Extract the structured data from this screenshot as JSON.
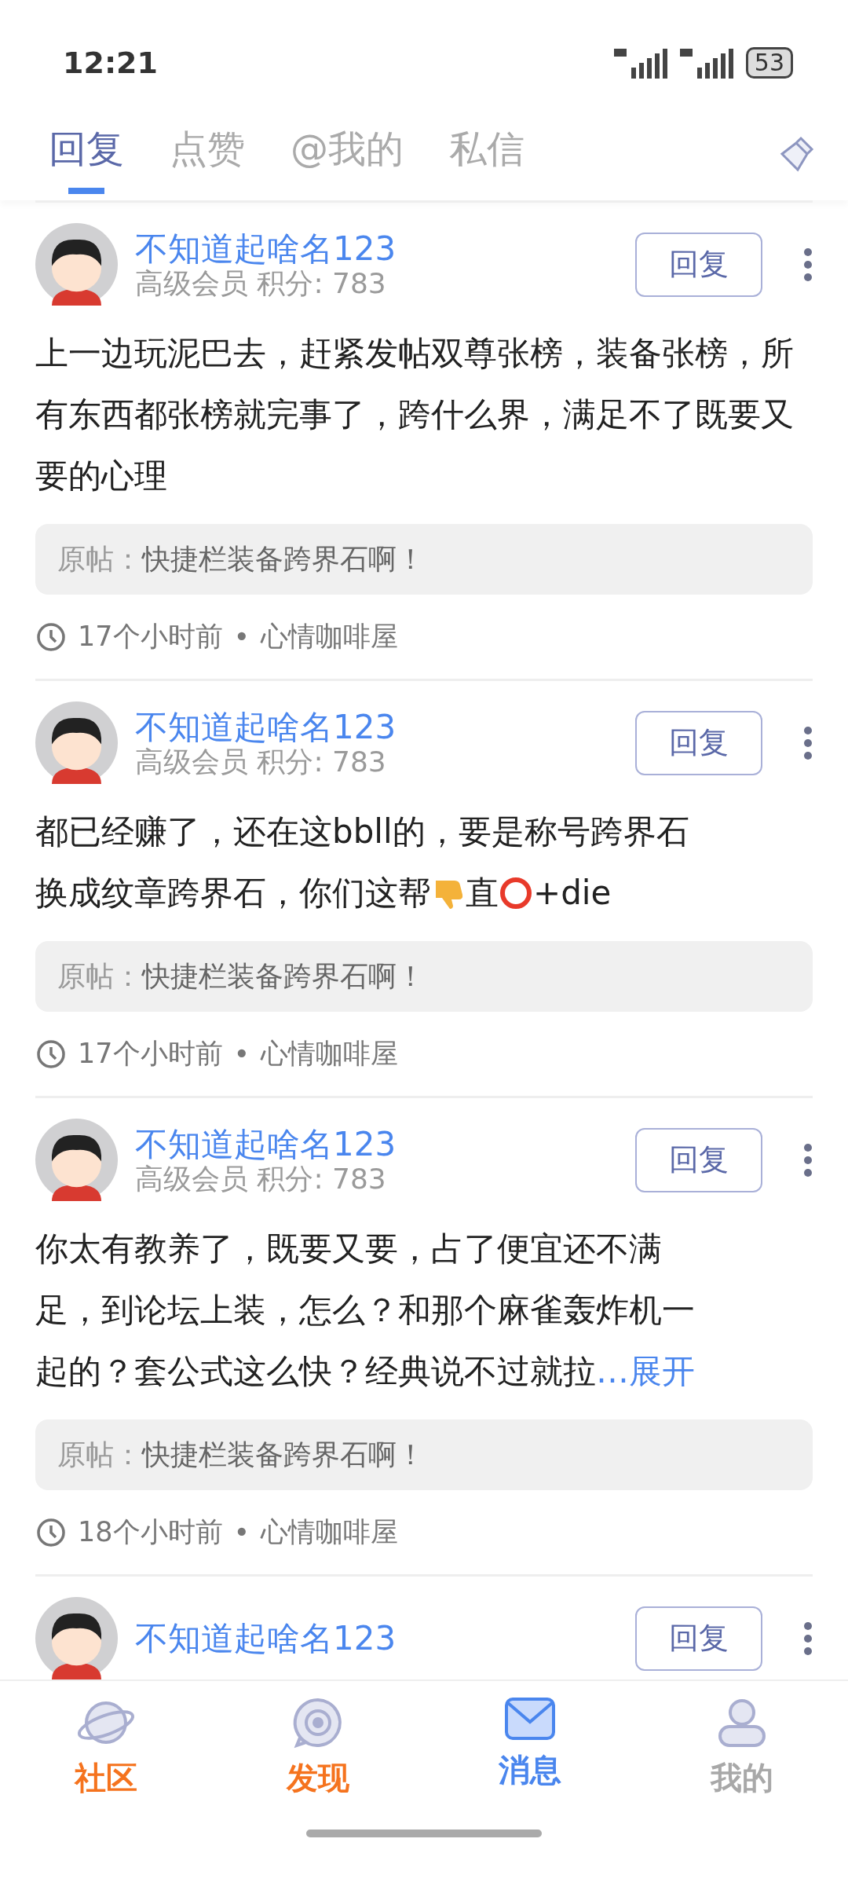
{
  "status_bar": {
    "time": "12:21",
    "battery": "53"
  },
  "tabs": [
    {
      "label": "回复",
      "selected": true
    },
    {
      "label": "点赞",
      "selected": false
    },
    {
      "label": "@我的",
      "selected": false
    },
    {
      "label": "私信",
      "selected": false
    }
  ],
  "replies": [
    {
      "user": "不知道起啥名123",
      "meta": "高级会员 积分: 783",
      "reply_button": "回复",
      "body": [
        {
          "kind": "text",
          "text": "上一边玩泥巴去，赶紧发帖双尊张榜，装备张榜，所有东西都张榜就完事了，跨什么界，满足不了既要又要的心理"
        }
      ],
      "quote_label": "原帖：",
      "quote": "快捷栏装备跨界石啊！",
      "time": "17个小时前",
      "separator": "•",
      "board": "心情咖啡屋"
    },
    {
      "user": "不知道起啥名123",
      "meta": "高级会员 积分: 783",
      "reply_button": "回复",
      "body": [
        {
          "kind": "text",
          "text": "都已经赚了，还在这bbll的，要是称号跨界石"
        },
        {
          "kind": "text",
          "text": "换成纹章跨界石，你们这帮"
        },
        {
          "kind": "thumbs_down"
        },
        {
          "kind": "text",
          "text": "直"
        },
        {
          "kind": "ring"
        },
        {
          "kind": "text",
          "text": "+die"
        }
      ],
      "quote_label": "原帖：",
      "quote": "快捷栏装备跨界石啊！",
      "time": "17个小时前",
      "separator": "•",
      "board": "心情咖啡屋"
    },
    {
      "user": "不知道起啥名123",
      "meta": "高级会员 积分: 783",
      "reply_button": "回复",
      "body": [
        {
          "kind": "text",
          "text": "你太有教养了，既要又要，占了便宜还不满"
        },
        {
          "kind": "text",
          "text": "足，到论坛上装，怎么？和那个麻雀轰炸机一"
        },
        {
          "kind": "text",
          "text": "起的？套公式这么快？经典说不过就拉"
        }
      ],
      "expand": "…展开",
      "quote_label": "原帖：",
      "quote": "快捷栏装备跨界石啊！",
      "time": "18个小时前",
      "separator": "•",
      "board": "心情咖啡屋"
    },
    {
      "user": "不知道起啥名123",
      "reply_button": "回复"
    }
  ],
  "bottom_nav": [
    {
      "label": "社区",
      "kind": "planet",
      "selected": false,
      "color": "#f5731e"
    },
    {
      "label": "发现",
      "kind": "bubble",
      "selected": false,
      "color": "#f5731e"
    },
    {
      "label": "消息",
      "kind": "mail",
      "selected": true,
      "color": "#4a86ee"
    },
    {
      "label": "我的",
      "kind": "person",
      "selected": false,
      "color": "#a8a8a8"
    }
  ]
}
